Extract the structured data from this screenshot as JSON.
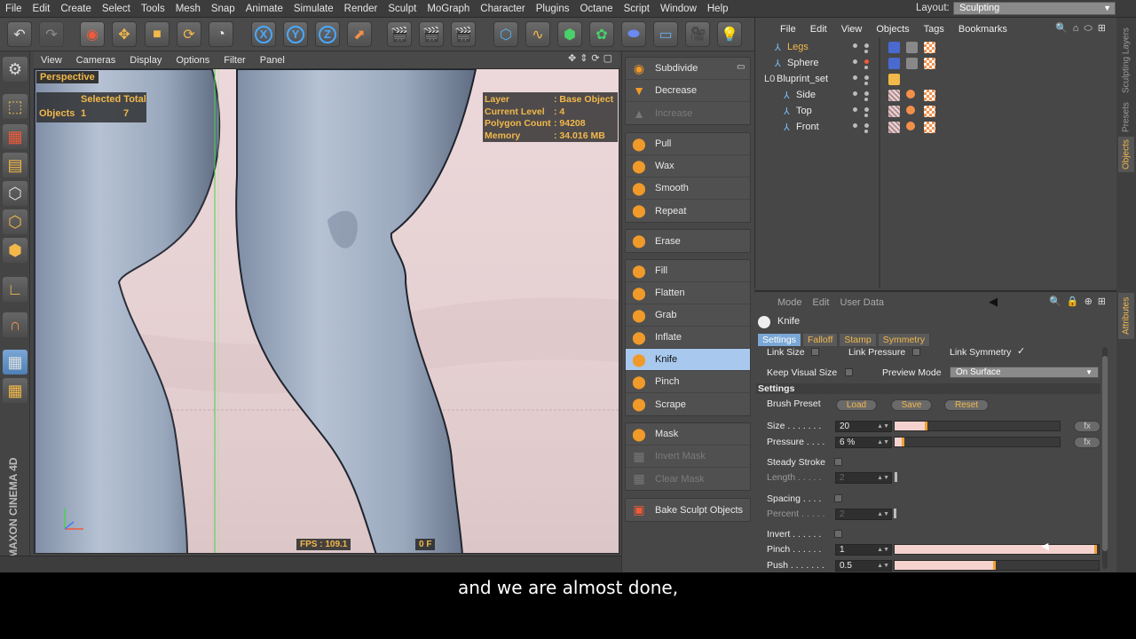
{
  "menubar": {
    "items": [
      "File",
      "Edit",
      "Create",
      "Select",
      "Tools",
      "Mesh",
      "Snap",
      "Animate",
      "Simulate",
      "Render",
      "Sculpt",
      "MoGraph",
      "Character",
      "Plugins",
      "Octane",
      "Script",
      "Window",
      "Help"
    ],
    "layout_label": "Layout:",
    "layout_value": "Sculpting"
  },
  "toolbar": {
    "axis_x": "X",
    "axis_y": "Y",
    "axis_z": "Z"
  },
  "viewport": {
    "menu": [
      "View",
      "Cameras",
      "Display",
      "Options",
      "Filter",
      "Panel"
    ],
    "label": "Perspective",
    "hud_selected_header": "Selected Total",
    "hud_objects_label": "Objects",
    "hud_objects_selected": "1",
    "hud_objects_total": "7",
    "info": [
      {
        "k": "Layer",
        "v": ": Base Object"
      },
      {
        "k": "Current Level",
        "v": ": 4"
      },
      {
        "k": "Polygon Count",
        "v": ": 94208"
      },
      {
        "k": "Memory",
        "v": ": 34.016 MB"
      }
    ],
    "fps": "FPS : 109.1",
    "frame": "0 F"
  },
  "brushes": {
    "group1": [
      {
        "label": "Subdivide",
        "icon": "subdivide-icon",
        "state": "normal"
      },
      {
        "label": "Decrease",
        "icon": "decrease-icon",
        "state": "normal"
      },
      {
        "label": "Increase",
        "icon": "increase-icon",
        "state": "dim"
      }
    ],
    "group2": [
      {
        "label": "Pull",
        "icon": "pull-icon",
        "state": "normal"
      },
      {
        "label": "Wax",
        "icon": "wax-icon",
        "state": "normal"
      },
      {
        "label": "Smooth",
        "icon": "smooth-icon",
        "state": "normal"
      },
      {
        "label": "Repeat",
        "icon": "repeat-icon",
        "state": "normal"
      }
    ],
    "group3": [
      {
        "label": "Erase",
        "icon": "erase-icon",
        "state": "normal"
      }
    ],
    "group4": [
      {
        "label": "Fill",
        "icon": "fill-icon",
        "state": "normal"
      },
      {
        "label": "Flatten",
        "icon": "flatten-icon",
        "state": "normal"
      },
      {
        "label": "Grab",
        "icon": "grab-icon",
        "state": "normal"
      },
      {
        "label": "Inflate",
        "icon": "inflate-icon",
        "state": "normal"
      },
      {
        "label": "Knife",
        "icon": "knife-icon",
        "state": "active"
      },
      {
        "label": "Pinch",
        "icon": "pinch-icon",
        "state": "normal"
      },
      {
        "label": "Scrape",
        "icon": "scrape-icon",
        "state": "normal"
      }
    ],
    "group5": [
      {
        "label": "Mask",
        "icon": "mask-icon",
        "state": "normal"
      },
      {
        "label": "Invert Mask",
        "icon": "invert-mask-icon",
        "state": "dim"
      },
      {
        "label": "Clear Mask",
        "icon": "clear-mask-icon",
        "state": "dim"
      }
    ],
    "group6": [
      {
        "label": "Bake Sculpt Objects",
        "icon": "bake-icon",
        "state": "normal"
      }
    ]
  },
  "objects": {
    "menu": [
      "File",
      "Edit",
      "View",
      "Objects",
      "Tags",
      "Bookmarks"
    ],
    "rows": [
      {
        "name": "Legs",
        "highlight": true
      },
      {
        "name": "Sphere",
        "highlight": false
      },
      {
        "name": "Bluprint_set",
        "highlight": false
      },
      {
        "name": "Side",
        "highlight": false
      },
      {
        "name": "Top",
        "highlight": false
      },
      {
        "name": "Front",
        "highlight": false
      }
    ]
  },
  "right_tabs": [
    "Sculpting Layers",
    "Presets",
    "Objects",
    "Attributes"
  ],
  "attributes": {
    "menu": [
      "Mode",
      "Edit",
      "User Data"
    ],
    "title": "Knife",
    "tabs": [
      "Settings",
      "Falloff",
      "Stamp",
      "Symmetry"
    ],
    "link_size": "Link Size",
    "link_pressure": "Link Pressure",
    "link_symmetry": "Link Symmetry",
    "keep_visual_size": "Keep Visual Size",
    "preview_mode_label": "Preview Mode",
    "preview_mode_value": "On Surface",
    "settings_header": "Settings",
    "brush_preset_label": "Brush Preset",
    "load": "Load",
    "save": "Save",
    "reset": "Reset",
    "size_label": "Size . . . . . . .",
    "size_value": "20",
    "size_fraction": 0.2,
    "pressure_label": "Pressure . . . .",
    "pressure_value": "6 %",
    "pressure_fraction": 0.06,
    "fx": "fx",
    "steady_stroke": "Steady Stroke",
    "length_label": "Length . . . . .",
    "length_value": "2",
    "spacing_label": "Spacing . . . .",
    "percent_label": "Percent . . . . .",
    "percent_value": "2",
    "invert_label": "Invert . . . . . .",
    "pinch_label": "Pinch . . . . . .",
    "pinch_value": "1",
    "pinch_fraction": 1.0,
    "push_label": "Push . . . . . . .",
    "push_value": "0.5",
    "push_fraction": 0.5
  },
  "branding": "MAXON CINEMA 4D",
  "subtitle": "and we are almost done,"
}
